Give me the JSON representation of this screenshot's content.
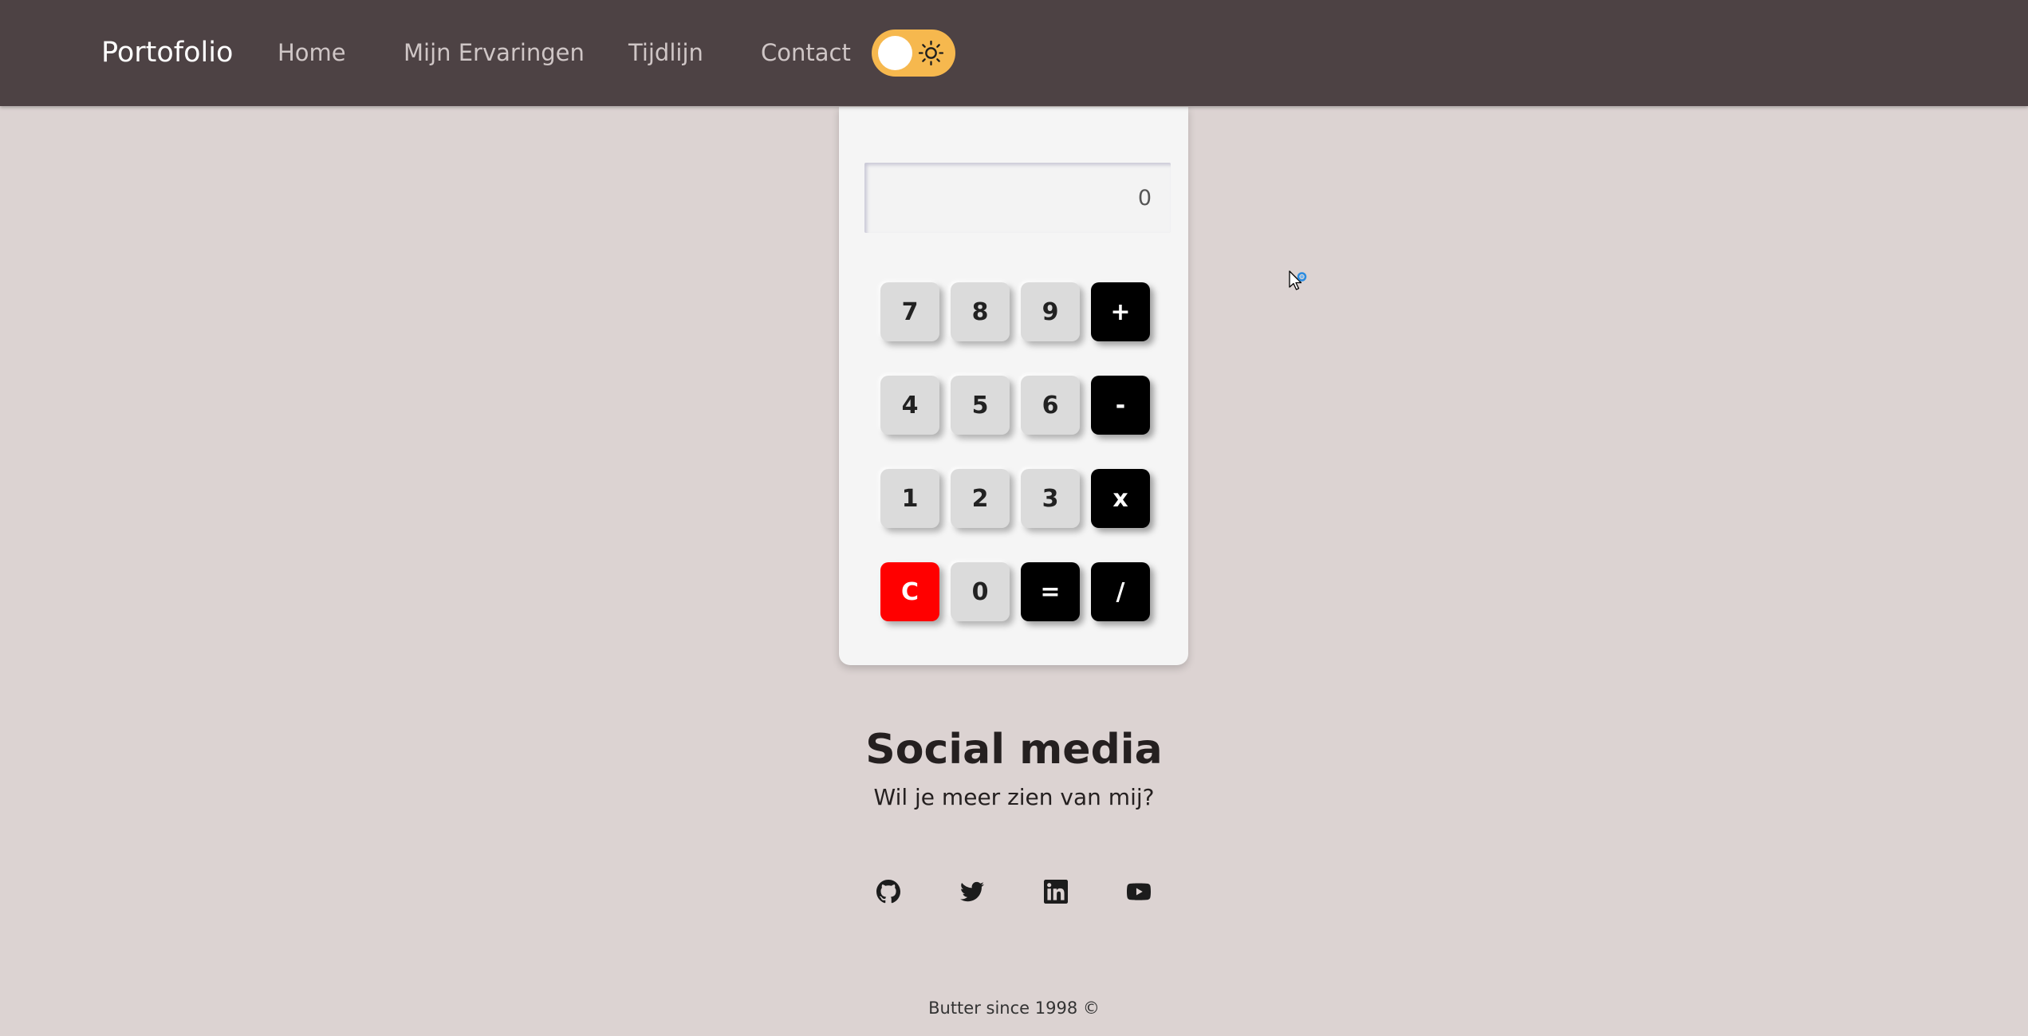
{
  "navbar": {
    "brand": "Portofolio",
    "links": [
      "Home",
      "Mijn Ervaringen",
      "Tijdlijn",
      "Contact"
    ],
    "theme_toggle": {
      "state": "light",
      "icon": "sun-icon",
      "track_color": "#f6b84e"
    }
  },
  "calculator": {
    "display_value": "0",
    "keys": [
      [
        "7",
        "8",
        "9",
        "+"
      ],
      [
        "4",
        "5",
        "6",
        "-"
      ],
      [
        "1",
        "2",
        "3",
        "x"
      ],
      [
        "C",
        "0",
        "=",
        "/"
      ]
    ],
    "colors": {
      "number_key": "#dbdbdb",
      "operator_key": "#000000",
      "clear_key": "#ff0000"
    }
  },
  "social": {
    "title": "Social media",
    "subtitle": "Wil je meer zien van mij?",
    "icons": [
      "github-icon",
      "twitter-icon",
      "linkedin-icon",
      "youtube-icon"
    ]
  },
  "footer": {
    "text": "Butter since 1998 ©"
  },
  "colors": {
    "background": "#dcd3d2",
    "navbar": "#4d4244"
  }
}
